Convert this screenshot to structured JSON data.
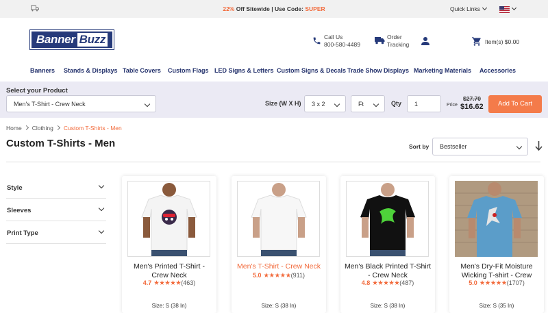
{
  "topbar": {
    "promo_percent": "22%",
    "promo_text": " Off Sitewide | Use Code: ",
    "promo_code": "SUPER",
    "quick_links": "Quick Links"
  },
  "header": {
    "logo_part1": "Banner",
    "logo_part2": "Buzz",
    "call_label": "Call Us",
    "phone": "800-580-4489",
    "track_line1": "Order",
    "track_line2": "Tracking",
    "cart_text": "Item(s)  $0.00"
  },
  "nav": [
    "Banners",
    "Stands & Displays",
    "Table Covers",
    "Custom Flags",
    "LED Signs & Letters",
    "Custom Signs & Decals",
    "Trade Show Displays",
    "Marketing Materials",
    "Accessories"
  ],
  "selector": {
    "label": "Select your Product",
    "product": "Men's T-Shirt - Crew Neck",
    "size_label": "Size (W X H)",
    "size_value": "3 x 2",
    "unit_value": "Ft",
    "qty_label": "Qty",
    "qty_value": "1",
    "price_label": "Price",
    "old_price": "$27.70",
    "new_price": "$16.62",
    "cart_button": "Add To Cart"
  },
  "breadcrumb": [
    "Home",
    "Clothing",
    "Custom T-Shirts - Men"
  ],
  "page_title": "Custom T-Shirts - Men",
  "sort": {
    "label": "Sort by",
    "value": "Bestseller"
  },
  "filters": [
    "Style",
    "Sleeves",
    "Print Type"
  ],
  "products": [
    {
      "name": "Men's Printed T-Shirt - Crew Neck",
      "rating": "4.7",
      "stars": "★★★★★",
      "count": "(463)",
      "size": "Size: S (38 In)"
    },
    {
      "name": "Men's T-Shirt - Crew Neck",
      "rating": "5.0",
      "stars": "★★★★★",
      "count": "(911)",
      "size": "Size: S (38 In)"
    },
    {
      "name": "Men's Black Printed T-Shirt - Crew Neck",
      "rating": "4.8",
      "stars": "★★★★★",
      "count": "(487)",
      "size": "Size: S (38 In)"
    },
    {
      "name": "Men's Dry-Fit Moisture Wicking T-shirt - Crew",
      "rating": "5.0",
      "stars": "★★★★★",
      "count": "(1707)",
      "size": "Size: S (35 In)"
    }
  ],
  "colors": {
    "accent": "#f26a3b",
    "navy": "#263a7a",
    "selector_bg": "#ebeaf4",
    "button": "#f47b4a"
  }
}
